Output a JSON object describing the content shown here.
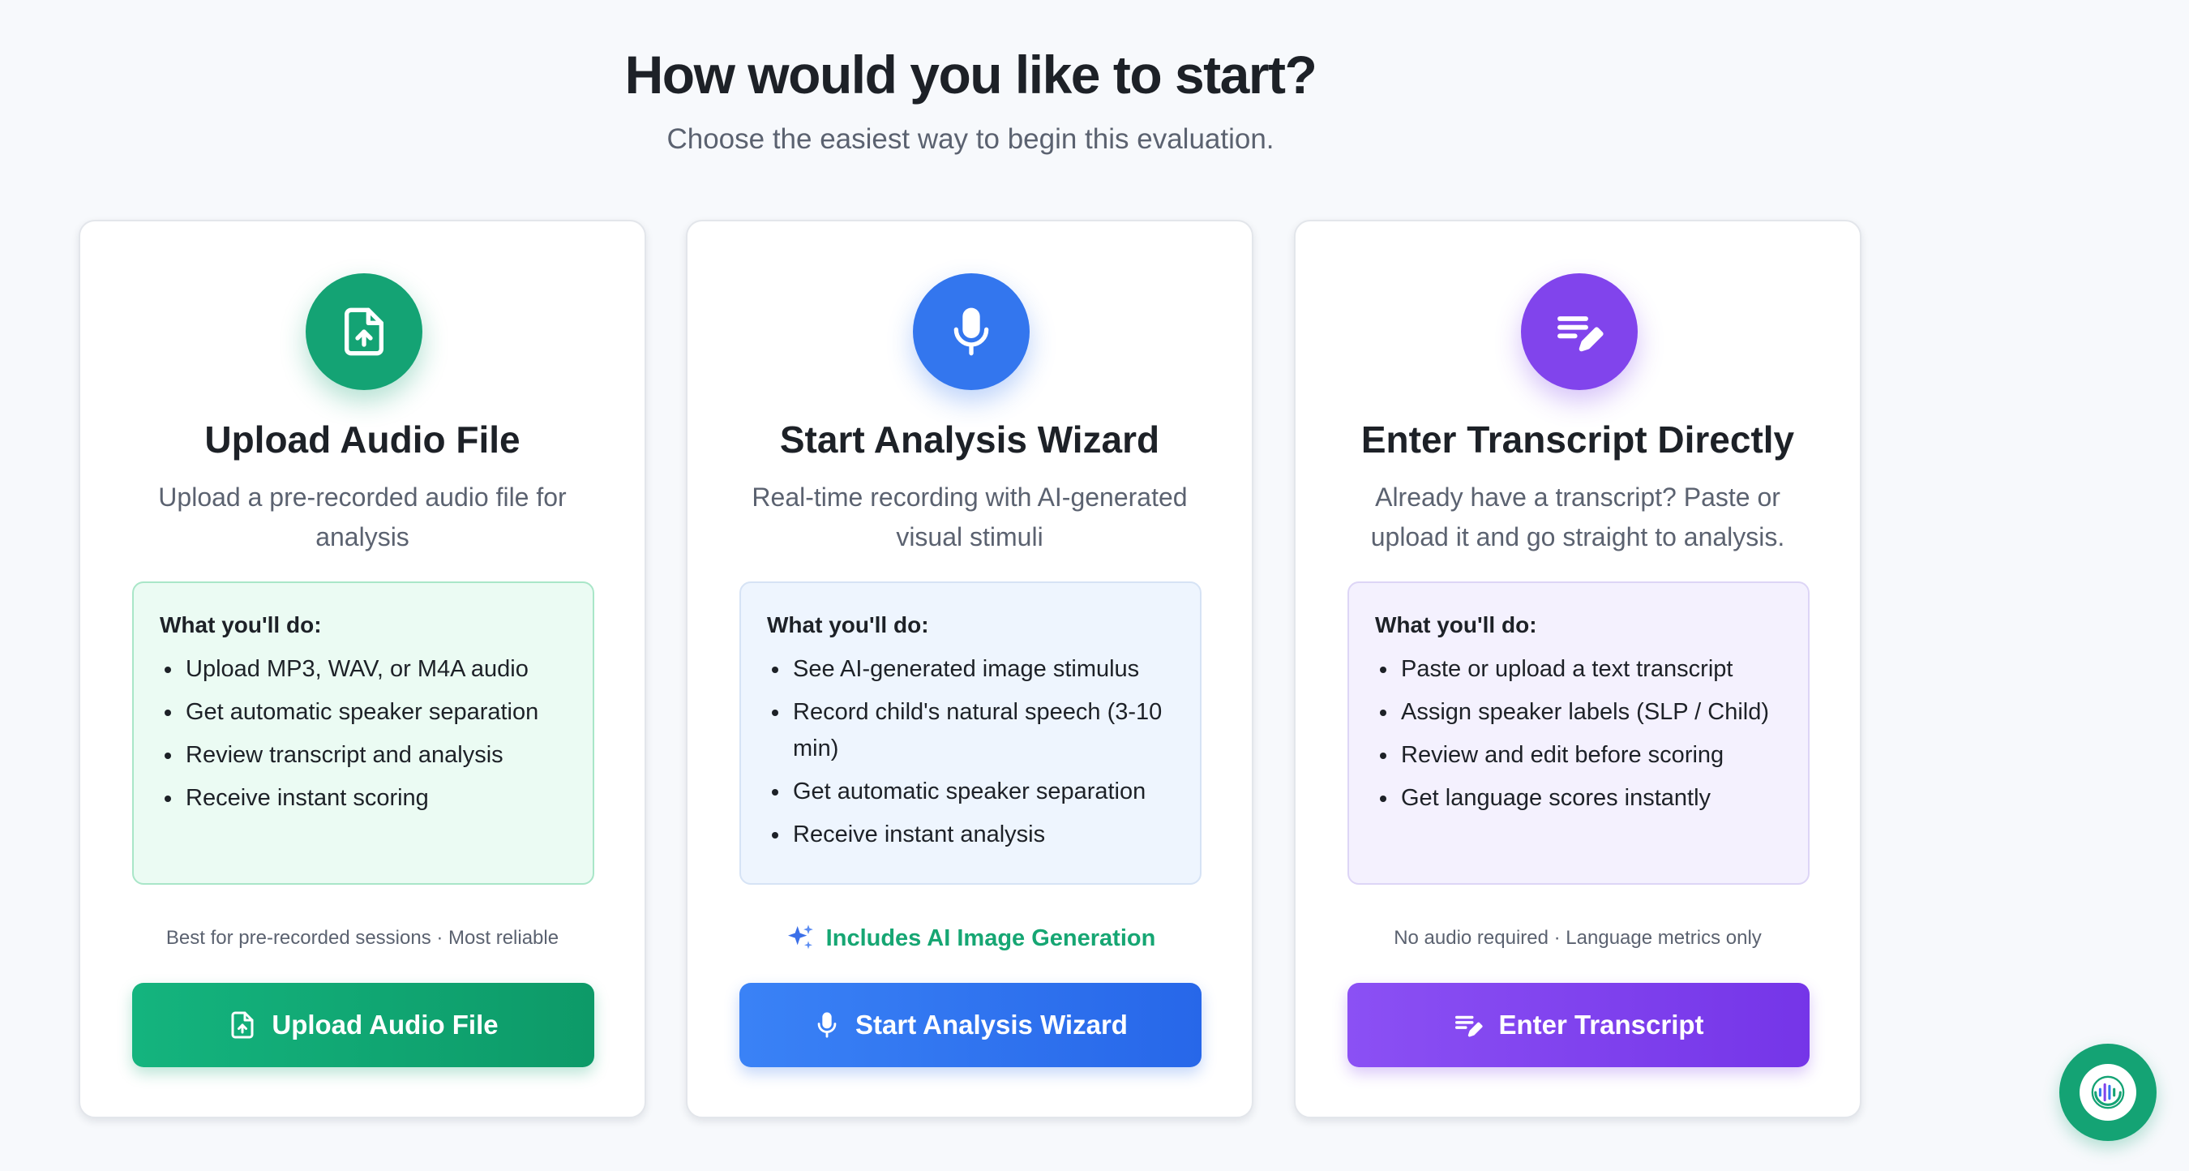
{
  "header": {
    "title": "How would you like to start?",
    "subtitle": "Choose the easiest way to begin this evaluation."
  },
  "colors": {
    "green": "#14a374",
    "blue": "#3376ee",
    "purple": "#8144ec",
    "ai_accent": "#16a673"
  },
  "cards": [
    {
      "icon": "file-upload-icon",
      "title": "Upload Audio File",
      "description": "Upload a pre-recorded audio file for analysis",
      "steps_heading": "What you'll do:",
      "steps": [
        "Upload MP3, WAV, or M4A audio",
        "Get automatic speaker separation",
        "Review transcript and analysis",
        "Receive instant scoring"
      ],
      "note": "Best for pre-recorded sessions · Most reliable",
      "button_label": "Upload Audio File",
      "button_icon": "file-upload-icon"
    },
    {
      "icon": "microphone-icon",
      "title": "Start Analysis Wizard",
      "description": "Real-time recording with AI-generated visual stimuli",
      "steps_heading": "What you'll do:",
      "steps": [
        "See AI-generated image stimulus",
        "Record child's natural speech (3-10 min)",
        "Get automatic speaker separation",
        "Receive instant analysis"
      ],
      "note": "Includes AI Image Generation",
      "note_icon": "sparkles-icon",
      "button_label": "Start Analysis Wizard",
      "button_icon": "microphone-icon"
    },
    {
      "icon": "edit-note-icon",
      "title": "Enter Transcript Directly",
      "description": "Already have a transcript? Paste or upload it and go straight to analysis.",
      "steps_heading": "What you'll do:",
      "steps": [
        "Paste or upload a text transcript",
        "Assign speaker labels (SLP / Child)",
        "Review and edit before scoring",
        "Get language scores instantly"
      ],
      "note": "No audio required · Language metrics only",
      "button_label": "Enter Transcript",
      "button_icon": "edit-note-icon"
    }
  ],
  "fab": {
    "icon": "assistant-voice-icon"
  }
}
